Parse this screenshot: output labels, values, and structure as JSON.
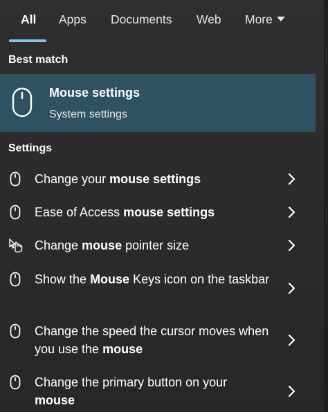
{
  "tabs": {
    "items": [
      {
        "label": "All"
      },
      {
        "label": "Apps"
      },
      {
        "label": "Documents"
      },
      {
        "label": "Web"
      },
      {
        "label": "More"
      }
    ],
    "active": "All"
  },
  "best_match": {
    "section_label": "Best match",
    "title": "Mouse settings",
    "subtitle": "System settings",
    "icon": "mouse-icon",
    "highlight_color": "#2f5263"
  },
  "settings": {
    "section_label": "Settings",
    "results": [
      {
        "parts": [
          {
            "t": "Change your ",
            "b": false
          },
          {
            "t": "mouse settings",
            "b": true
          }
        ],
        "icon": "mouse-icon"
      },
      {
        "parts": [
          {
            "t": "Ease of Access ",
            "b": false
          },
          {
            "t": "mouse settings",
            "b": true
          }
        ],
        "icon": "mouse-icon"
      },
      {
        "parts": [
          {
            "t": "Change ",
            "b": false
          },
          {
            "t": "mouse",
            "b": true
          },
          {
            "t": " pointer size",
            "b": false
          }
        ],
        "icon": "hand-pointer-icon"
      },
      {
        "parts": [
          {
            "t": "Show the ",
            "b": false
          },
          {
            "t": "Mouse",
            "b": true
          },
          {
            "t": " Keys icon on the taskbar",
            "b": false
          }
        ],
        "icon": "mouse-icon"
      },
      {
        "parts": [
          {
            "t": "Change the speed the cursor moves when you use the ",
            "b": false
          },
          {
            "t": "mouse",
            "b": true
          }
        ],
        "icon": "mouse-icon"
      },
      {
        "parts": [
          {
            "t": "Change the primary button on your ",
            "b": false
          },
          {
            "t": "mouse",
            "b": true
          }
        ],
        "icon": "mouse-icon"
      }
    ]
  },
  "colors": {
    "accent_underline": "#7ec8e3",
    "background": "#2b2b2b"
  }
}
